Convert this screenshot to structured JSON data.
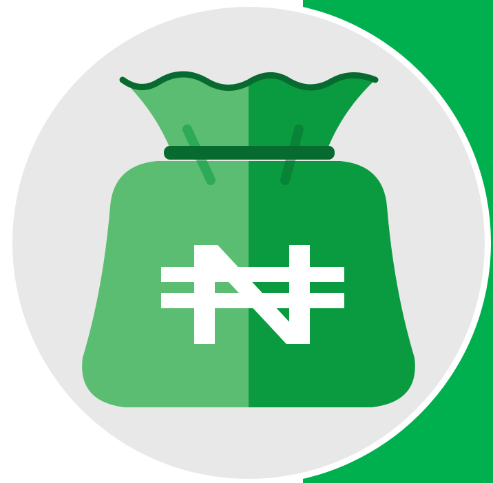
{
  "icon": {
    "name": "naira-money-bag-icon",
    "currency_symbol": "₦"
  },
  "colors": {
    "page_background": "#ffffff",
    "accent_green": "#00b04f",
    "circle_background": "#e8e8e8",
    "circle_border": "#ffffff",
    "bag_light": "#5abd72",
    "bag_dark": "#0a9b40",
    "bag_tie": "#076a2f",
    "symbol": "#ffffff"
  }
}
